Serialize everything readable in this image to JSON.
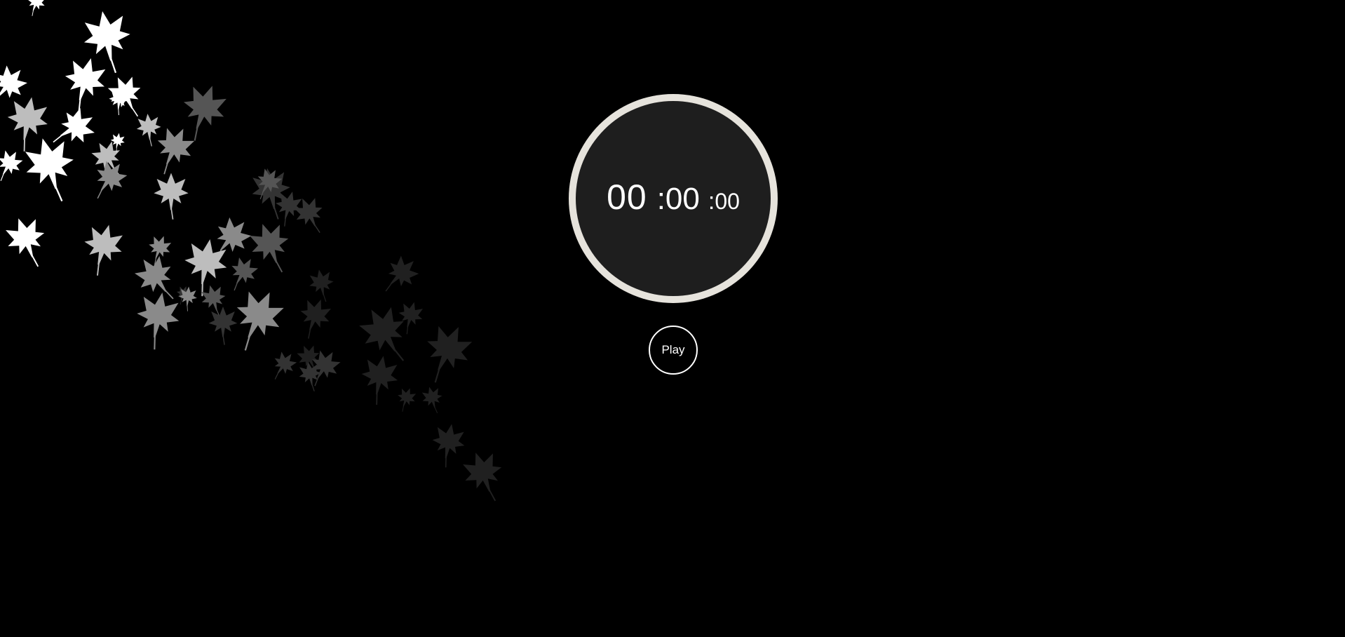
{
  "timer": {
    "hours": "00",
    "separator_1": ":",
    "minutes": "00",
    "separator_2": ":",
    "seconds": "00",
    "ring_color": "#e6e3dc",
    "face_color": "#1e1e1e"
  },
  "controls": {
    "play_label": "Play"
  },
  "background": {
    "color": "#000000",
    "decoration_icon": "maple-leaf-icon",
    "leaf_colors": [
      "#ffffff",
      "#bdbdbd",
      "#8a8a8a",
      "#555555",
      "#333333",
      "#202020"
    ]
  }
}
